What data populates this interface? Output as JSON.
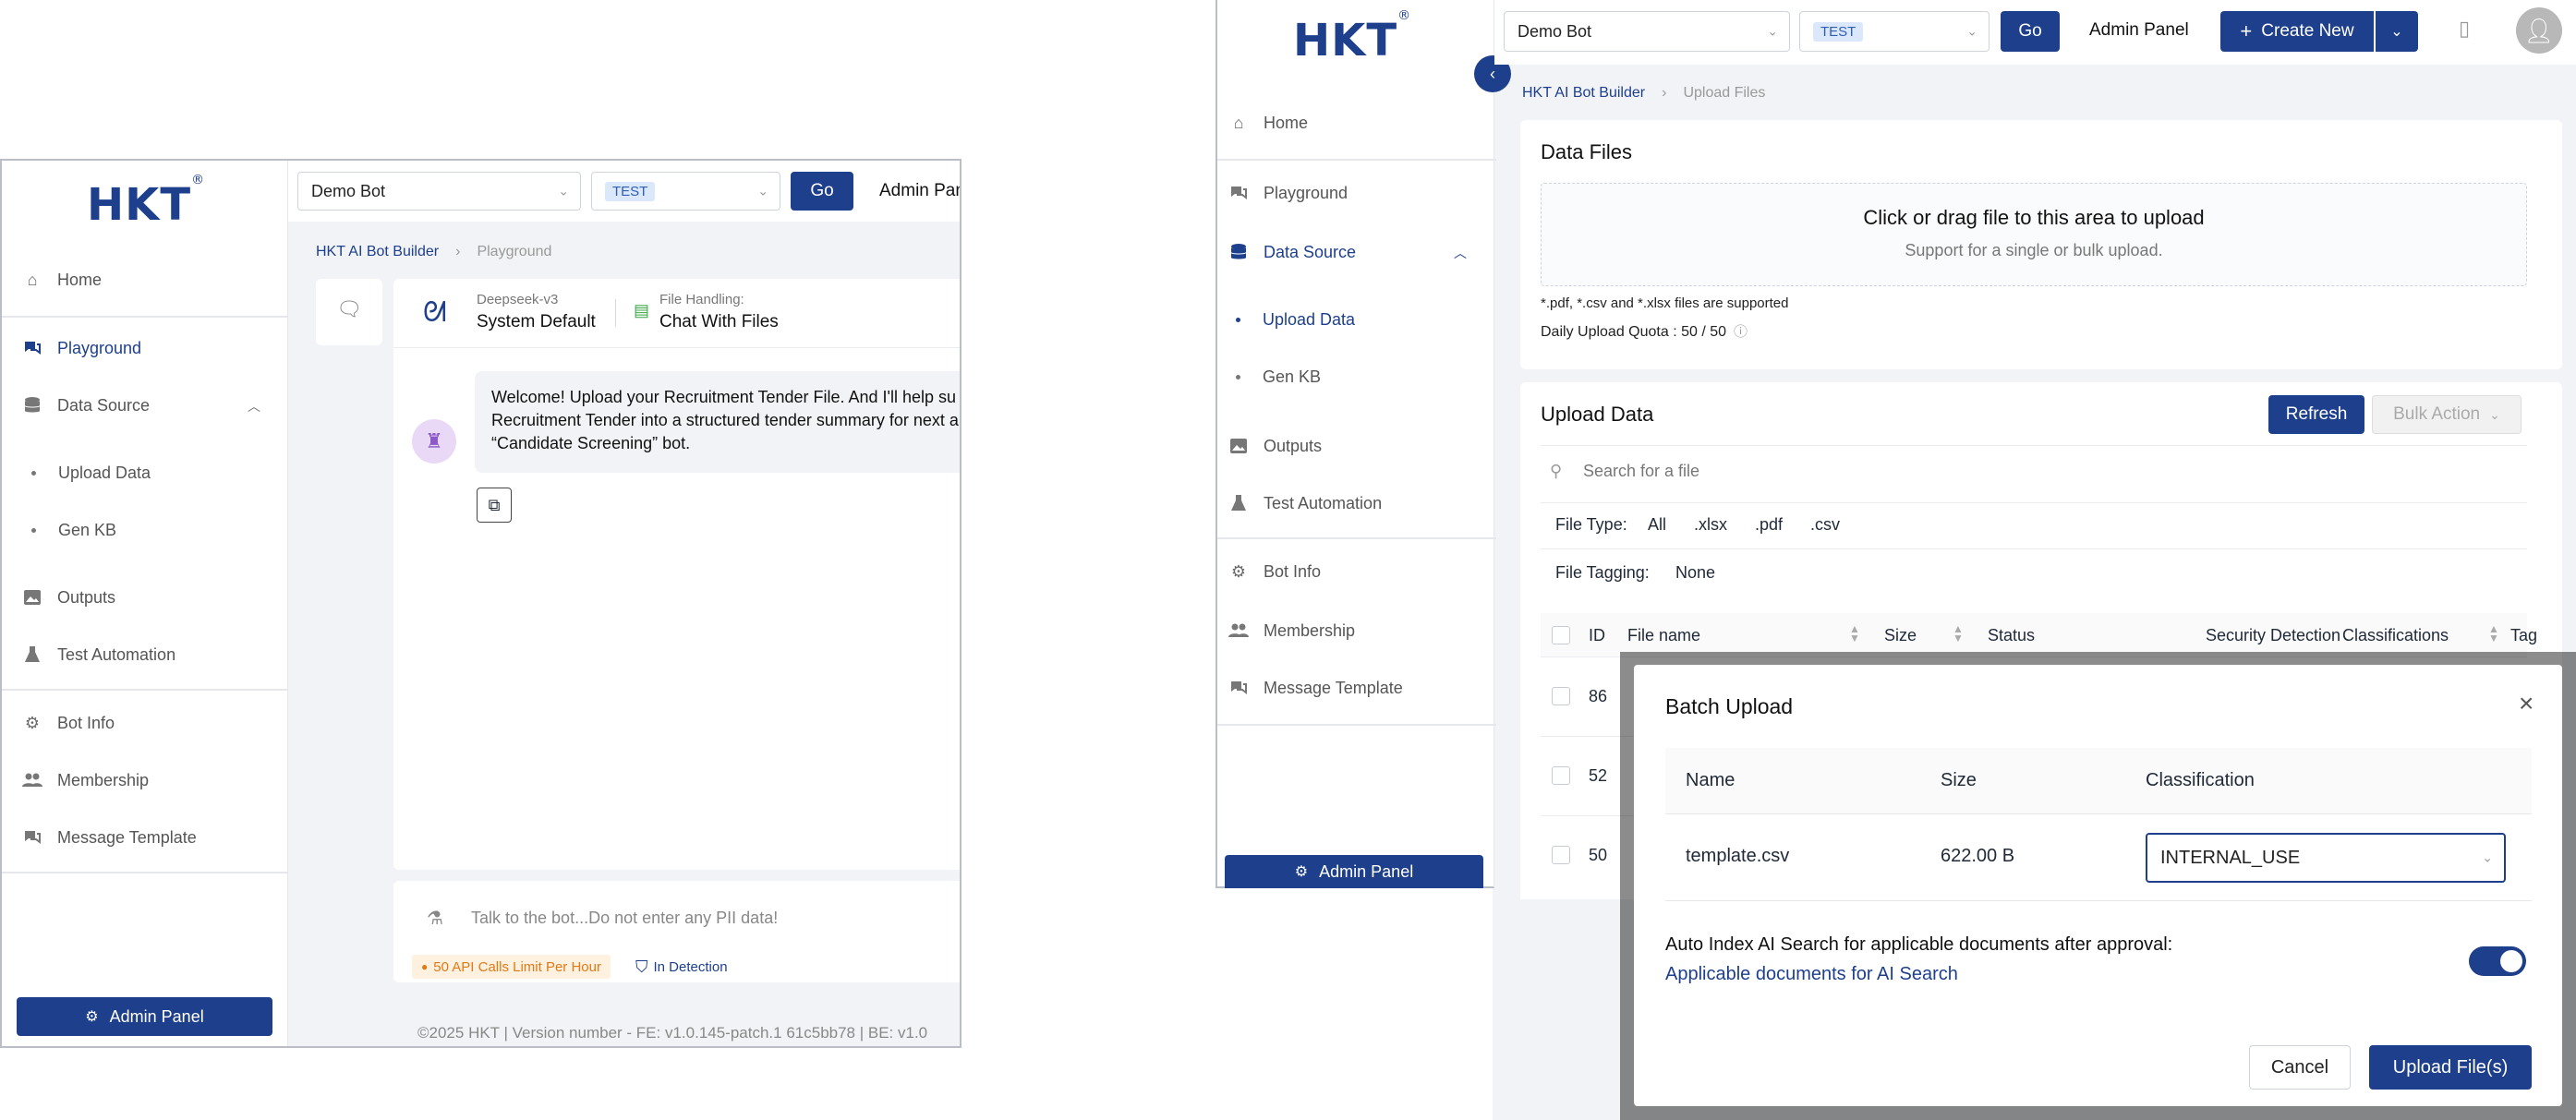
{
  "left": {
    "logo": "HKT",
    "logo_mark": "®",
    "bot_select": "Demo Bot",
    "env_tag": "TEST",
    "go_label": "Go",
    "admin_panel_top": "Admin Panel",
    "breadcrumb": {
      "root": "HKT AI Bot Builder",
      "current": "Playground"
    },
    "nav": {
      "home": "Home",
      "playground": "Playground",
      "data_source": "Data Source",
      "upload_data": "Upload Data",
      "gen_kb": "Gen KB",
      "outputs": "Outputs",
      "test_automation": "Test Automation",
      "bot_info": "Bot Info",
      "membership": "Membership",
      "message_template": "Message Template"
    },
    "admin_button": "Admin Panel",
    "model": {
      "label": "Deepseek-v3",
      "value": "System Default"
    },
    "file_handling": {
      "label": "File Handling:",
      "value": "Chat With Files"
    },
    "message": {
      "line1": "Welcome! Upload your Recruitment Tender File. And I'll help su",
      "line2": "Recruitment Tender into a structured tender summary for next a",
      "line3": "“Candidate Screening” bot."
    },
    "chat_placeholder": "Talk to the bot...Do not enter any PII data!",
    "api_limit_badge": "50 API Calls Limit Per Hour",
    "detection_label": "In Detection",
    "footer": "©2025 HKT | Version number - FE: v1.0.145-patch.1 61c5bb78 | BE: v1.0"
  },
  "right": {
    "logo": "HKT",
    "logo_mark": "®",
    "bot_select": "Demo Bot",
    "env_tag": "TEST",
    "go_label": "Go",
    "admin_panel_top": "Admin Panel",
    "create_new": "Create New",
    "breadcrumb": {
      "root": "HKT AI Bot Builder",
      "current": "Upload Files"
    },
    "nav": {
      "home": "Home",
      "playground": "Playground",
      "data_source": "Data Source",
      "upload_data": "Upload Data",
      "gen_kb": "Gen KB",
      "outputs": "Outputs",
      "test_automation": "Test Automation",
      "bot_info": "Bot Info",
      "membership": "Membership",
      "message_template": "Message Template"
    },
    "admin_button": "Admin Panel",
    "data_files": {
      "title": "Data Files",
      "drop_title": "Click or drag file to this area to upload",
      "drop_sub": "Support for a single or bulk upload.",
      "supported": "*.pdf, *.csv and *.xlsx files are supported",
      "quota": "Daily Upload Quota : 50 / 50"
    },
    "upload_data": {
      "title": "Upload Data",
      "refresh": "Refresh",
      "bulk_action": "Bulk Action",
      "search_placeholder": "Search for a file",
      "file_type_label": "File Type:",
      "file_types": [
        "All",
        ".xlsx",
        ".pdf",
        ".csv"
      ],
      "file_tagging_label": "File Tagging:",
      "file_tagging_value": "None",
      "columns": {
        "id": "ID",
        "file_name": "File name",
        "size": "Size",
        "status": "Status",
        "security": "Security Detection",
        "classifications": "Classifications",
        "tag": "Tag"
      },
      "row_ids": [
        "86",
        "52",
        "50"
      ]
    },
    "modal": {
      "title": "Batch Upload",
      "columns": {
        "name": "Name",
        "size": "Size",
        "classification": "Classification"
      },
      "row": {
        "name": "template.csv",
        "size": "622.00 B",
        "classification": "INTERNAL_USE"
      },
      "auto_index_text": "Auto Index AI Search for applicable documents after approval:",
      "applicable_link": "Applicable documents for AI Search",
      "auto_index_enabled": true,
      "cancel": "Cancel",
      "upload": "Upload File(s)"
    }
  }
}
